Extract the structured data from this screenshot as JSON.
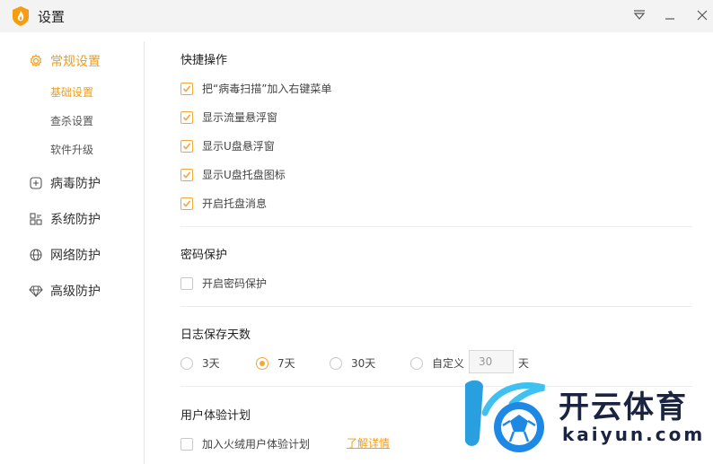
{
  "window": {
    "title": "设置",
    "brand_color": "#f49c12"
  },
  "titlebar": {
    "menu_icon": "dropdown-triangle-icon",
    "minimize_icon": "minimize-icon",
    "close_icon": "close-icon"
  },
  "sidebar": {
    "groups": [
      {
        "label": "常规设置",
        "icon": "gear-icon",
        "active": true
      },
      {
        "label": "病毒防护",
        "icon": "plus-square-icon",
        "active": false
      },
      {
        "label": "系统防护",
        "icon": "grid-icon",
        "active": false
      },
      {
        "label": "网络防护",
        "icon": "globe-icon",
        "active": false
      },
      {
        "label": "高级防护",
        "icon": "diamond-icon",
        "active": false
      }
    ],
    "subitems": [
      {
        "label": "基础设置",
        "active": true
      },
      {
        "label": "查杀设置",
        "active": false
      },
      {
        "label": "软件升级",
        "active": false
      }
    ]
  },
  "shortcut": {
    "title": "快捷操作",
    "options": [
      {
        "label": "把“病毒扫描”加入右键菜单",
        "checked": true
      },
      {
        "label": "显示流量悬浮窗",
        "checked": true
      },
      {
        "label": "显示U盘悬浮窗",
        "checked": true
      },
      {
        "label": "显示U盘托盘图标",
        "checked": true
      },
      {
        "label": "开启托盘消息",
        "checked": true
      }
    ]
  },
  "password": {
    "title": "密码保护",
    "option": {
      "label": "开启密码保护",
      "checked": false
    }
  },
  "log": {
    "title": "日志保存天数",
    "options": [
      {
        "label": "3天",
        "checked": false
      },
      {
        "label": "7天",
        "checked": true
      },
      {
        "label": "30天",
        "checked": false
      },
      {
        "label": "自定义",
        "checked": false
      }
    ],
    "custom_value": "30",
    "custom_unit": "天"
  },
  "experience": {
    "title": "用户体验计划",
    "option": {
      "label": "加入火绒用户体验计划",
      "checked": false
    },
    "link": "了解详情"
  },
  "watermark": {
    "cn": "开云体育",
    "en": "kaiyun.com"
  }
}
